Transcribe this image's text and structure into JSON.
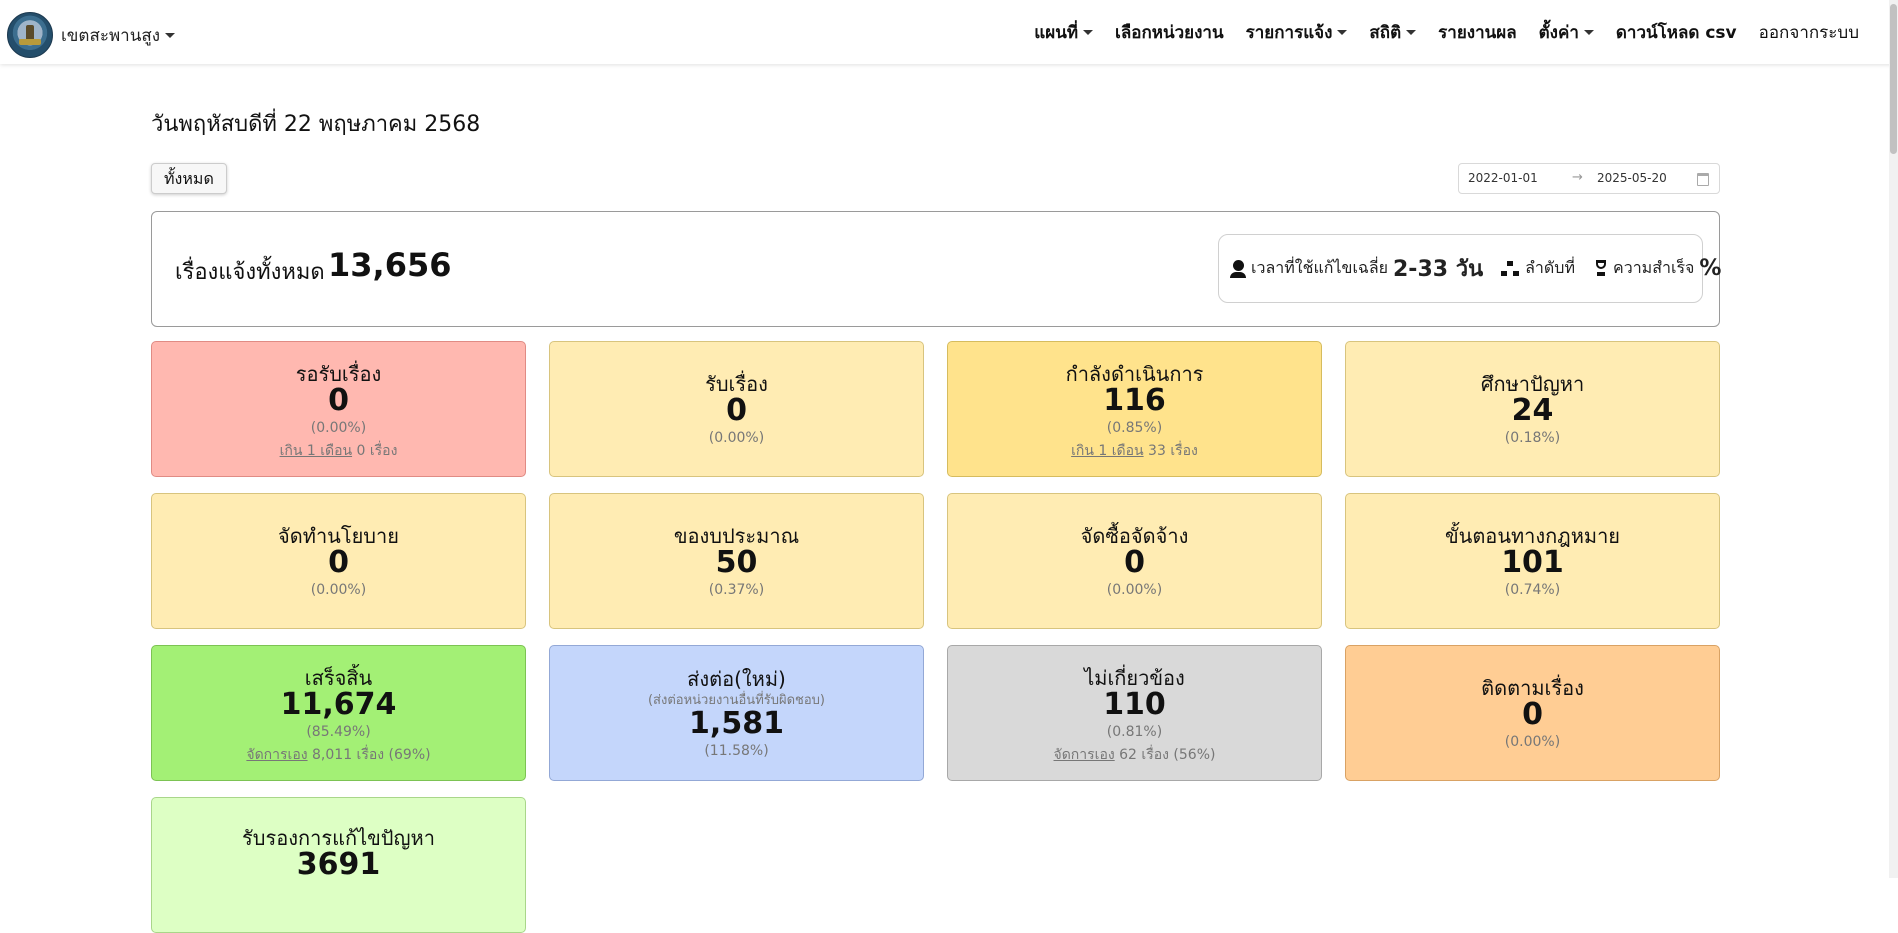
{
  "navbar": {
    "brand": "เขตสะพานสูง",
    "menu": [
      {
        "label": "แผนที่",
        "dropdown": true
      },
      {
        "label": "เลือกหน่วยงาน",
        "dropdown": false
      },
      {
        "label": "รายการแจ้ง",
        "dropdown": true
      },
      {
        "label": "สถิติ",
        "dropdown": true
      },
      {
        "label": "รายงานผล",
        "dropdown": false
      },
      {
        "label": "ตั้งค่า",
        "dropdown": true
      },
      {
        "label": "ดาวน์โหลด csv",
        "dropdown": false
      },
      {
        "label": "ออกจากระบบ",
        "dropdown": false
      }
    ]
  },
  "page": {
    "date_title": "วันพฤหัสบดีที่ 22 พฤษภาคม 2568",
    "filter_button": "ทั้งหมด",
    "date_range": {
      "start": "2022-01-01",
      "end": "2025-05-20",
      "separator": "→"
    }
  },
  "summary": {
    "label": "เรื่องแจ้งทั้งหมด",
    "value": "13,656",
    "avg_time_label": "เวลาที่ใช้แก้ไขเฉลี่ย",
    "avg_time_value": "2-33 วัน",
    "rank_label": "ลำดับที่",
    "success_label": "ความสำเร็จ",
    "success_value": "%"
  },
  "cards": [
    {
      "title": "รอรับเรื่อง",
      "value": "0",
      "pct": "(0.00%)",
      "note_link": "เกิน 1 เดือน",
      "note_text": " 0 เรื่อง",
      "color": "#ffb8b0",
      "border": "#e08b84"
    },
    {
      "title": "รับเรื่อง",
      "value": "0",
      "pct": "(0.00%)",
      "color": "#ffecb3",
      "border": "#d8c47e"
    },
    {
      "title": "กำลังดำเนินการ",
      "value": "116",
      "pct": "(0.85%)",
      "note_link": "เกิน 1 เดือน",
      "note_text": " 33 เรื่อง",
      "color": "#ffe38c",
      "border": "#d6bc5e"
    },
    {
      "title": "ศึกษาปัญหา",
      "value": "24",
      "pct": "(0.18%)",
      "color": "#ffecb3",
      "border": "#d8c47e"
    },
    {
      "title": "จัดทำนโยบาย",
      "value": "0",
      "pct": "(0.00%)",
      "color": "#ffecb3",
      "border": "#d8c47e"
    },
    {
      "title": "ของบประมาณ",
      "value": "50",
      "pct": "(0.37%)",
      "color": "#ffecb3",
      "border": "#d8c47e"
    },
    {
      "title": "จัดซื้อจัดจ้าง",
      "value": "0",
      "pct": "(0.00%)",
      "color": "#ffecb3",
      "border": "#d8c47e"
    },
    {
      "title": "ขั้นตอนทางกฎหมาย",
      "value": "101",
      "pct": "(0.74%)",
      "color": "#ffecb3",
      "border": "#d8c47e"
    },
    {
      "title": "เสร็จสิ้น",
      "value": "11,674",
      "pct": "(85.49%)",
      "note_link": "จัดการเอง",
      "note_text": " 8,011 เรื่อง (69%)",
      "color": "#a3f075",
      "border": "#7cc353"
    },
    {
      "title": "ส่งต่อ(ใหม่)",
      "sub": "(ส่งต่อหน่วยงานอื่นที่รับผิดชอบ)",
      "value": "1,581",
      "pct": "(11.58%)",
      "color": "#c4d6fb",
      "border": "#93a8d6"
    },
    {
      "title": "ไม่เกี่ยวข้อง",
      "value": "110",
      "pct": "(0.81%)",
      "note_link": "จัดการเอง",
      "note_text": " 62 เรื่อง (56%)",
      "color": "#d9d9d9",
      "border": "#a8a8a8"
    },
    {
      "title": "ติดตามเรื่อง",
      "value": "0",
      "pct": "(0.00%)",
      "color": "#ffcd94",
      "border": "#d9a264"
    },
    {
      "title": "รับรองการแก้ไขปัญหา",
      "value": "3691",
      "color": "#ddffc4",
      "border": "#a9d68a"
    }
  ]
}
